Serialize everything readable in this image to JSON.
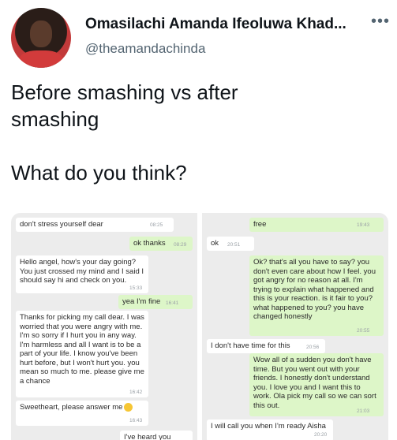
{
  "author": {
    "name": "Omasilachi Amanda Ifeoluwa Khad...",
    "handle": "@theamandachinda",
    "more_icon": "more-horizontal-icon"
  },
  "tweet": {
    "text": "Before smashing vs after\nsmashing\n\nWhat do you think?"
  },
  "left_chat": {
    "messages": [
      {
        "dir": "in",
        "text": "don't stress yourself dear",
        "time": "08:25"
      },
      {
        "dir": "out",
        "text": "ok thanks",
        "time": "08:29"
      },
      {
        "dir": "in",
        "text": "Hello angel, how's your day going? You just crossed my mind and I said I should say hi and check on you.",
        "time": "15:33"
      },
      {
        "dir": "out",
        "text": "yea I'm fine",
        "time": "16:41"
      },
      {
        "dir": "in",
        "text": "Thanks for picking my call dear. I was worried that you were angry with me. I'm so sorry if I hurt you in any way. I'm harmless and all I want is to be a part of your life. I know you've been hurt before, but I won't hurt you. you mean so much to me. please give me a chance",
        "time": "16:42"
      },
      {
        "dir": "in",
        "text": "Sweetheart, please answer me",
        "time": "16:43"
      },
      {
        "dir": "in",
        "text": "I've heard you",
        "time": ""
      }
    ]
  },
  "right_chat": {
    "messages": [
      {
        "dir": "out",
        "text": "free",
        "time": "19:43"
      },
      {
        "dir": "in",
        "text": "ok",
        "time": "20:51"
      },
      {
        "dir": "out",
        "text": "Ok? that's all you have to say? you don't even care about how I feel. you got angry for no reason at all. I'm trying to explain what happened and this is your reaction. is it fair to you? what happened to you? you have changed honestly",
        "time": "20:55"
      },
      {
        "dir": "in",
        "text": "I don't have time for this",
        "time": "20:56"
      },
      {
        "dir": "out",
        "text": "Wow all of a sudden you don't have time. But you went out with your friends. I honestly don't understand you. I love you and I want this to work. Ola pick my call so we can sort this out.",
        "time": "21:03"
      },
      {
        "dir": "in",
        "text": "I will call you when I'm ready Aisha",
        "time": "20:20"
      }
    ]
  }
}
